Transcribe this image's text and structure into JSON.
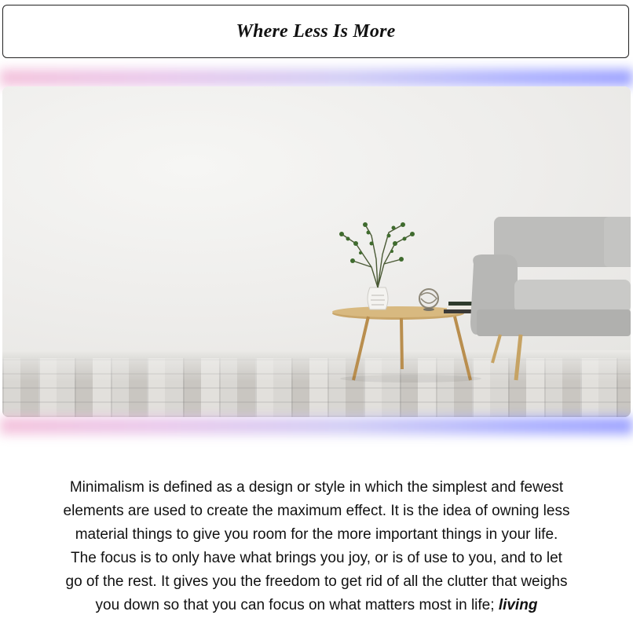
{
  "header": {
    "title": "Where Less Is More"
  },
  "hero_image": {
    "alt": "Minimalist living room with grey sofa, round wooden side table, vase with branches, decorative sphere and books"
  },
  "body": {
    "text": "Minimalism is defined as a design or style in which the simplest and fewest elements are used to create the maximum effect. It is the idea of owning less material things to give you room for the more important things in your life. The focus is to only have what brings you joy, or is of use to you, and to let go of the rest. It gives you the freedom to get rid of all the clutter that weighs you down so that you can focus on what matters most in life; ",
    "emphasis": "living"
  },
  "colors": {
    "glow_left": "#f2b8d6",
    "glow_right": "#8c92ff",
    "border": "#222222"
  }
}
